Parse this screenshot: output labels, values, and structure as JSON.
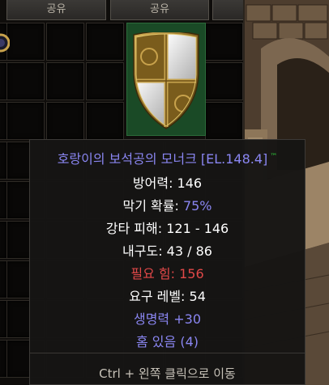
{
  "tabs": [
    "공유",
    "공유",
    ""
  ],
  "item": {
    "title": "호랑이의 보석공의 모너크 [EL.148.4]",
    "trademark": "™",
    "defense_label": "방어력: ",
    "defense_value": "146",
    "block_label": "막기 확률: ",
    "block_value": "75%",
    "smite_label": "강타 피해: ",
    "smite_value": "121 - 146",
    "durability_label": "내구도: ",
    "durability_value": "43 / 86",
    "req_str_label": "필요 힘: ",
    "req_str_value": "156",
    "req_level_label": "요구 레벨: ",
    "req_level_value": "54",
    "life": "생명력 +30",
    "sockets": "홈 있음 (4)"
  },
  "footer": "Ctrl + 왼쪽 클릭으로 이동",
  "colors": {
    "title": "#8a86f2",
    "magic_stat": "#8a86f2",
    "requirement_unmet": "#e04848",
    "trademark": "#2fd43d",
    "item_slot_bg": "#1a4a26"
  },
  "icons": {
    "shield": "monarch-shield-icon",
    "socket": "gem-socket-icon"
  }
}
